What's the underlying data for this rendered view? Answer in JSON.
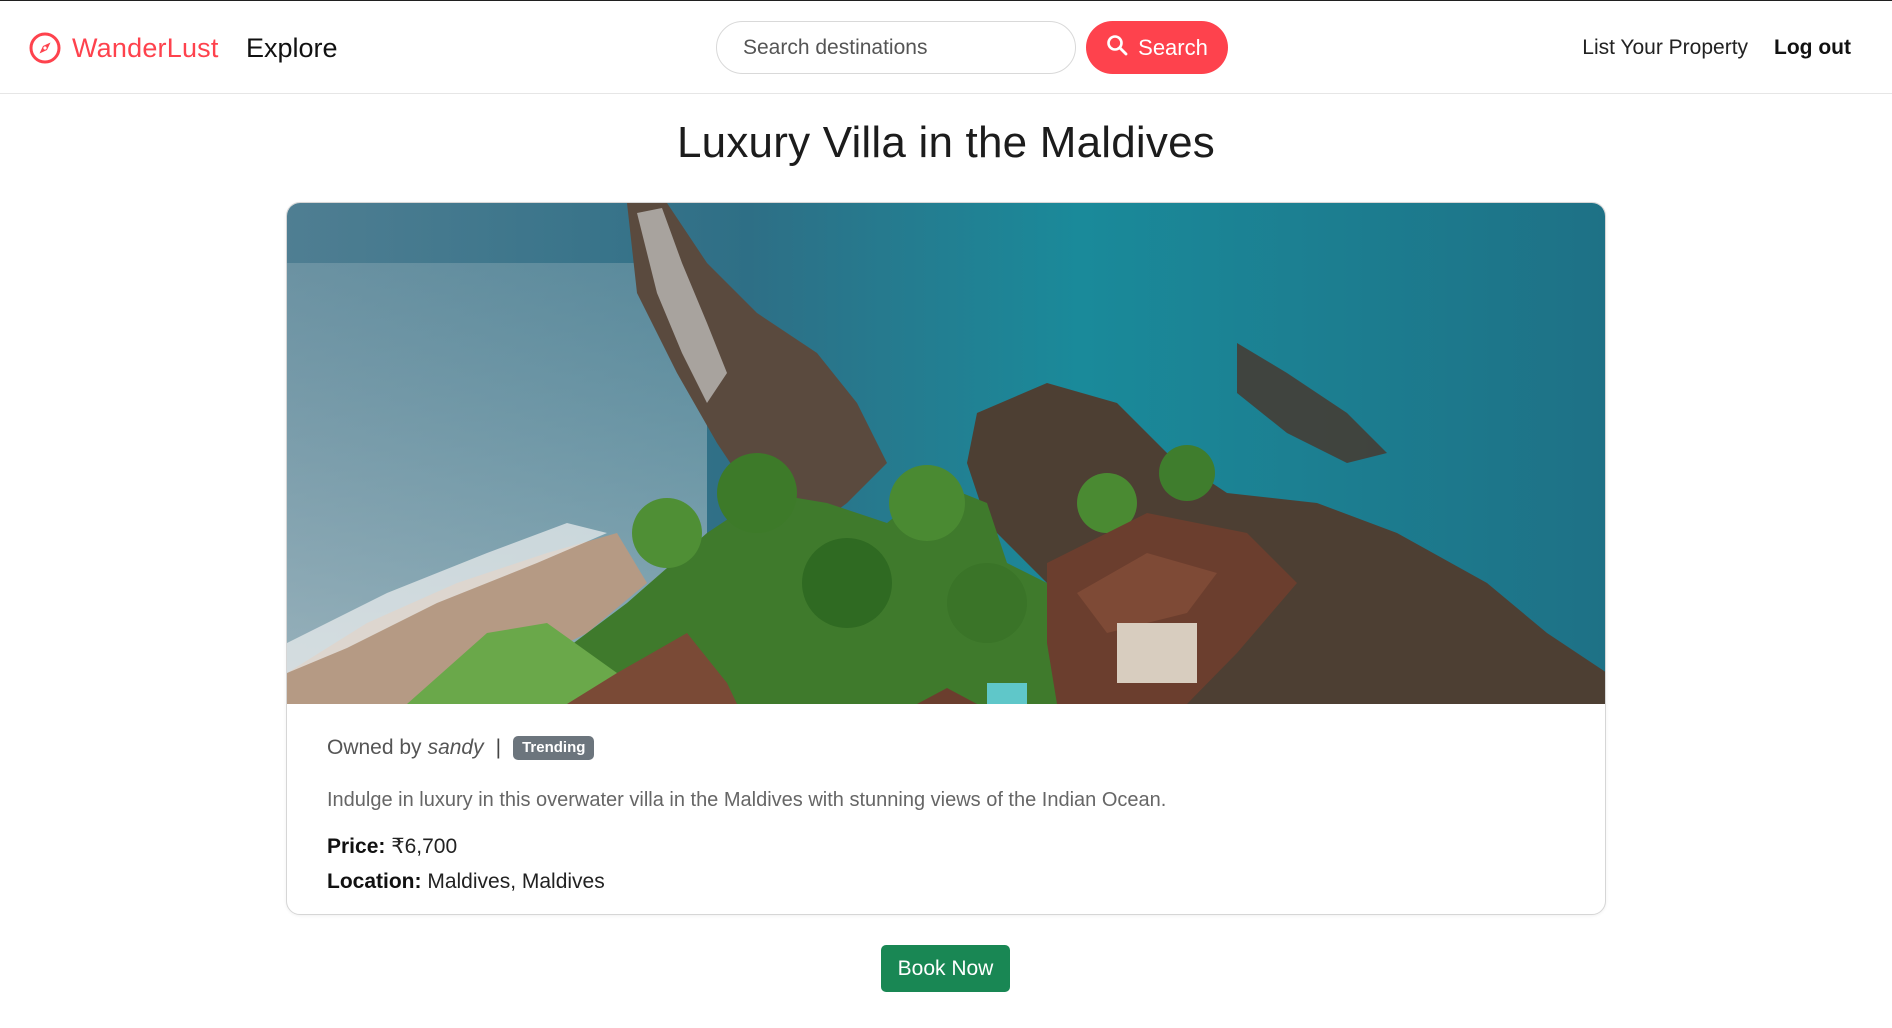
{
  "navbar": {
    "brand_name": "WanderLust",
    "brand_color": "#fe424d",
    "brand_icon": "compass-icon",
    "explore_label": "Explore",
    "search": {
      "placeholder": "Search destinations",
      "value": "",
      "button_label": "Search",
      "button_icon": "search-icon"
    },
    "list_property_label": "List Your Property",
    "logout_label": "Log out"
  },
  "listing": {
    "title": "Luxury Villa in the Maldives",
    "image_alt": "Aerial view of villa on rocky coastline",
    "owned_by_label": "Owned by",
    "owner": "sandy",
    "separator": "|",
    "badge": "Trending",
    "description": "Indulge in luxury in this overwater villa in the Maldives with stunning views of the Indian Ocean.",
    "price_label": "Price:",
    "price_value": "₹6,700",
    "location_label": "Location:",
    "location_value": "Maldives, Maldives"
  },
  "actions": {
    "book_label": "Book Now",
    "book_color": "#198754"
  }
}
